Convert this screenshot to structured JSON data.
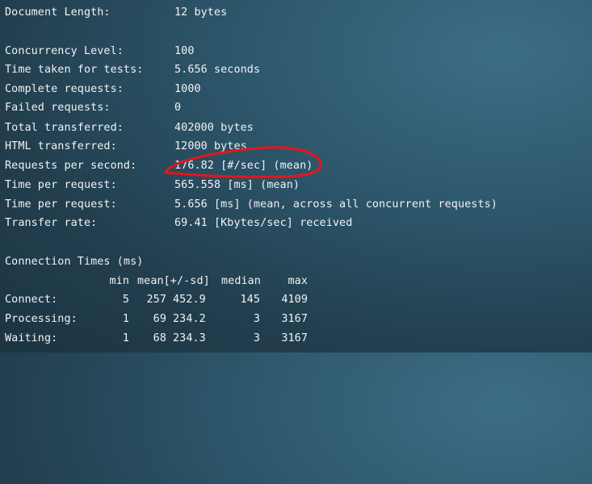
{
  "results": [
    {
      "label": "Document Length:",
      "value": "12 bytes"
    },
    {
      "label": "Concurrency Level:",
      "value": "100"
    },
    {
      "label": "Time taken for tests:",
      "value": "5.656 seconds"
    },
    {
      "label": "Complete requests:",
      "value": "1000"
    },
    {
      "label": "Failed requests:",
      "value": "0"
    },
    {
      "label": "Total transferred:",
      "value": "402000 bytes"
    },
    {
      "label": "HTML transferred:",
      "value": "12000 bytes"
    },
    {
      "label": "Requests per second:",
      "value": "176.82 [#/sec] (mean)"
    },
    {
      "label": "Time per request:",
      "value": "565.558 [ms] (mean)"
    },
    {
      "label": "Time per request:",
      "value": "5.656 [ms] (mean, across all concurrent requests)"
    },
    {
      "label": "Transfer rate:",
      "value": "69.41 [Kbytes/sec] received"
    }
  ],
  "connection_times": {
    "title": "Connection Times (ms)",
    "headers": {
      "min": "min",
      "mean_sd": "mean[+/-sd]",
      "median": "median",
      "max": "max"
    },
    "rows": [
      {
        "label": "Connect:",
        "min": "5",
        "mean": "257",
        "sd": "452.9",
        "median": "145",
        "max": "4109"
      },
      {
        "label": "Processing:",
        "min": "1",
        "mean": "69",
        "sd": "234.2",
        "median": "3",
        "max": "3167"
      },
      {
        "label": "Waiting:",
        "min": "1",
        "mean": "68",
        "sd": "234.3",
        "median": "3",
        "max": "3167"
      }
    ]
  },
  "annotation": {
    "color": "#e8141e"
  }
}
